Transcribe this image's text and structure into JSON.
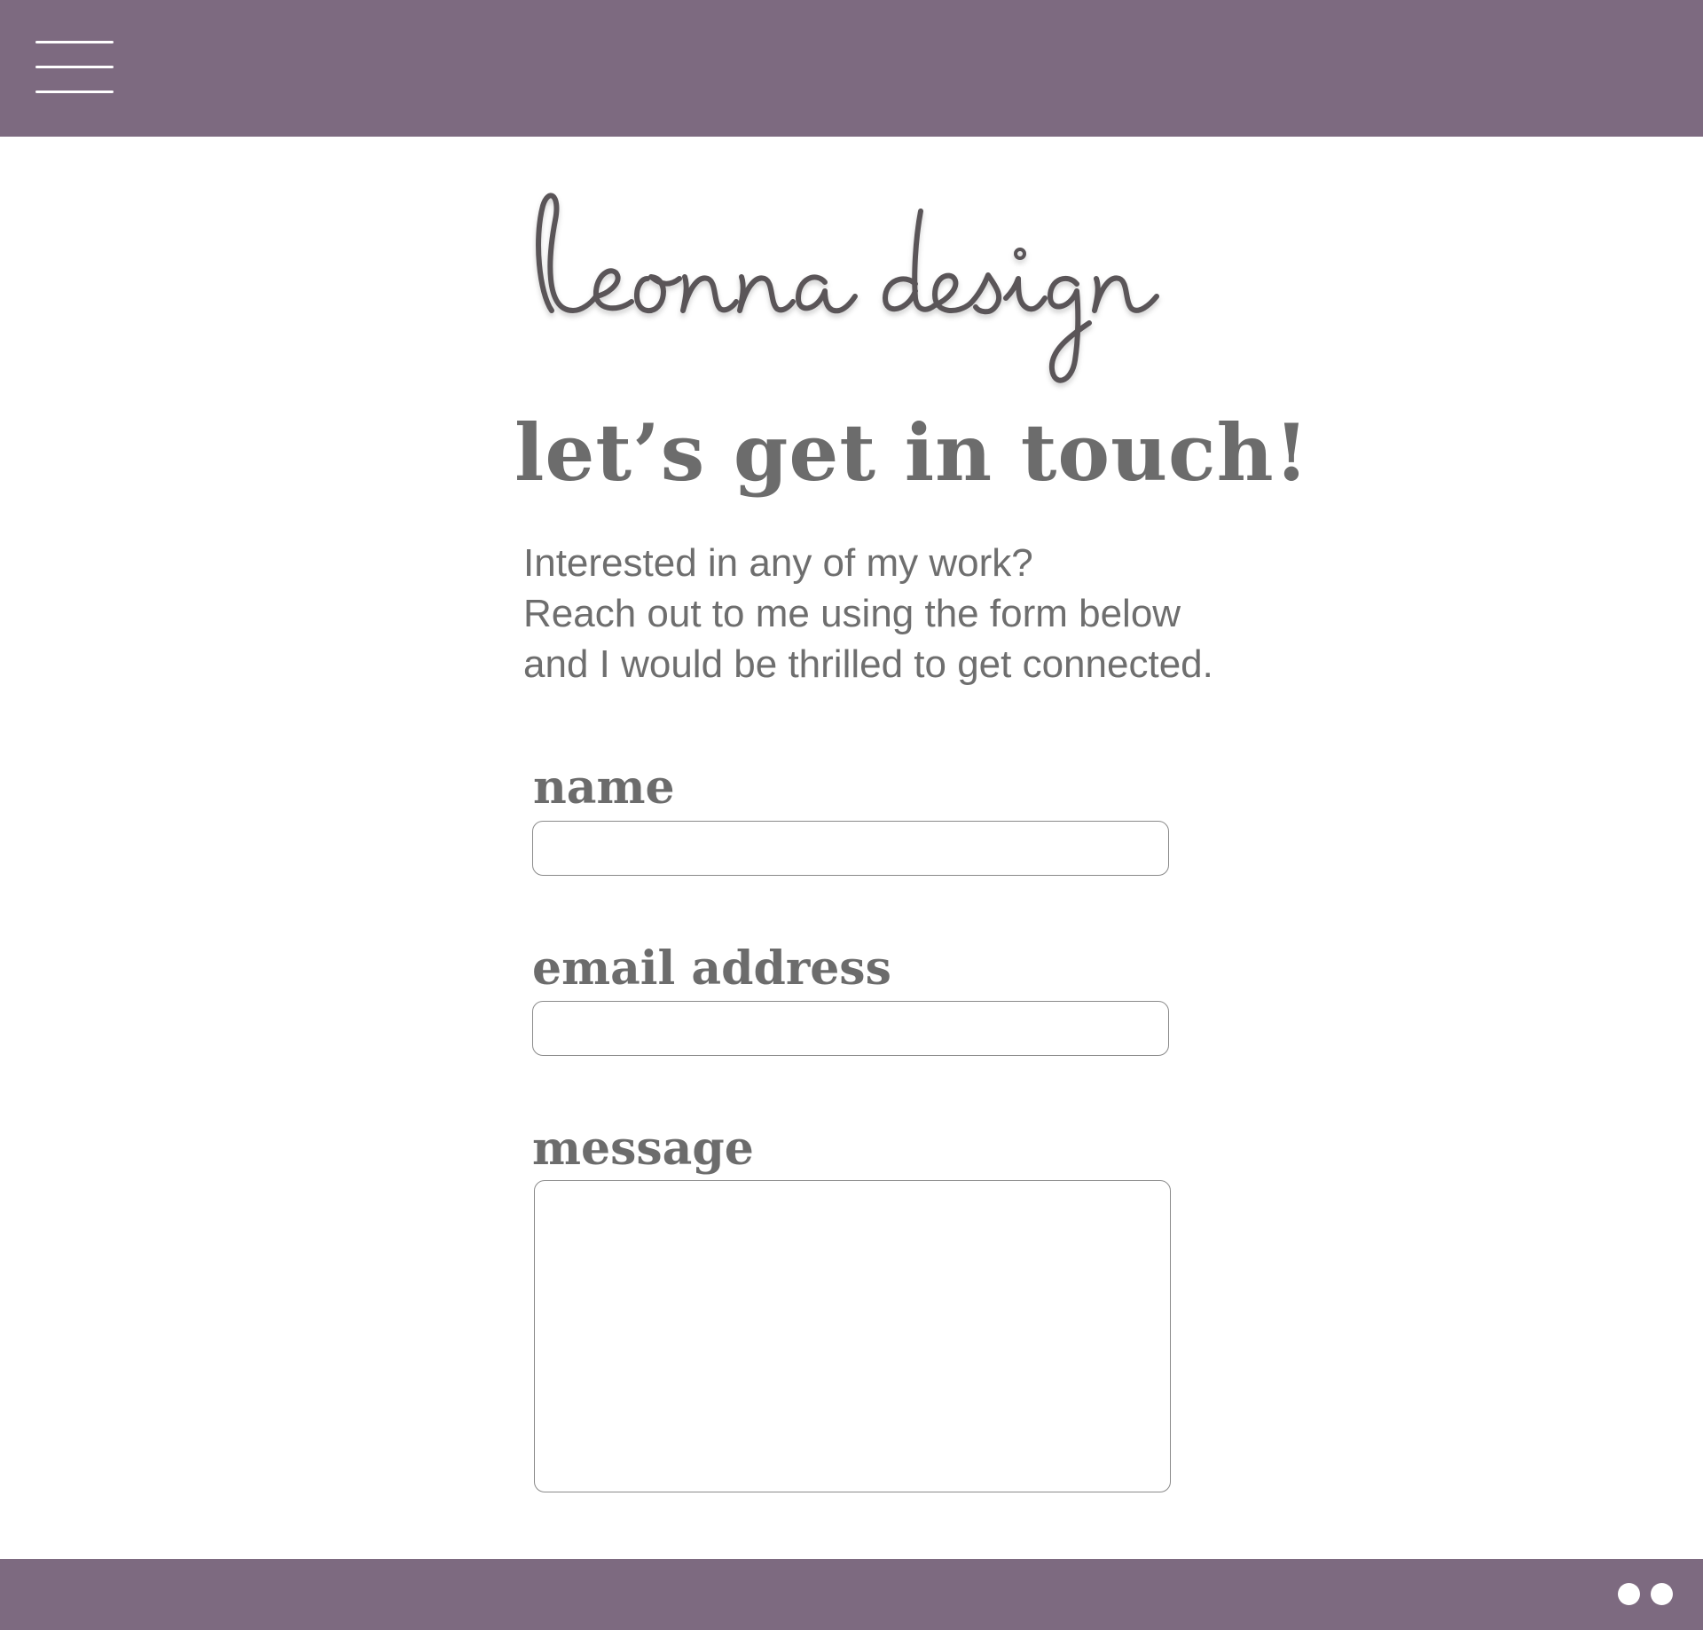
{
  "header": {
    "menu_icon": "hamburger-menu-icon",
    "background_color": "#7d6a80"
  },
  "brand": {
    "logo_text": "leonna design"
  },
  "hero": {
    "title": "let’s get in touch!",
    "intro_lines": [
      "Interested in any of my work?",
      "Reach out to me using the form below",
      "and I would be thrilled to get connected."
    ]
  },
  "form": {
    "name": {
      "label": "name",
      "value": "",
      "placeholder": ""
    },
    "email": {
      "label": "email address",
      "value": "",
      "placeholder": ""
    },
    "message": {
      "label": "message",
      "value": "",
      "placeholder": ""
    }
  },
  "footer": {
    "background_color": "#7d6a80",
    "pagination_dots": 2,
    "dot_color": "#ffffff"
  },
  "colors": {
    "accent": "#7d6a80",
    "text": "#6c6c6c",
    "logo": "#5a5558"
  }
}
